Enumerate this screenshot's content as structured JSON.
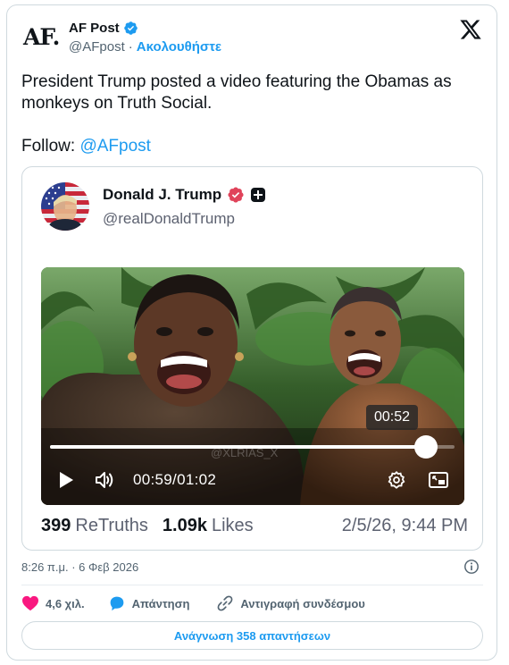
{
  "author": {
    "logo_text": "AF.",
    "name": "AF Post",
    "handle": "@AFpost",
    "separator": "·",
    "follow_label": "Ακολουθήστε"
  },
  "tweet": {
    "text": "President Trump posted a video featuring the Obamas as monkeys on Truth Social.",
    "follow_prefix": "Follow: ",
    "follow_handle": "@AFpost"
  },
  "embed": {
    "name": "Donald J. Trump",
    "handle": "@realDonaldTrump",
    "video": {
      "watermark": "@XLRIAS_X",
      "tooltip_time": "00:52",
      "current_time": "00:59",
      "time_separator": "/",
      "duration": "01:02",
      "progress_fraction": 0.93
    },
    "stats": {
      "retruths_count": "399",
      "retruths_label": "ReTruths",
      "likes_count": "1.09k",
      "likes_label": "Likes",
      "date": "2/5/26, 9:44 PM"
    }
  },
  "footer": {
    "timestamp": "8:26 π.μ. · 6 Φεβ 2026",
    "like_count": "4,6 χιλ.",
    "reply_label": "Απάντηση",
    "copy_link_label": "Αντιγραφή συνδέσμου",
    "read_replies_label": "Ανάγνωση 358 απαντήσεων"
  },
  "colors": {
    "accent": "#1d9bf0",
    "like": "#f91880",
    "truth_badge": "#e0435a"
  },
  "icons": [
    "verified-badge-icon",
    "x-logo-icon",
    "truth-verified-icon",
    "plus-badge-icon",
    "play-icon",
    "volume-icon",
    "settings-icon",
    "pip-icon",
    "info-icon",
    "heart-icon",
    "reply-icon",
    "link-icon"
  ]
}
